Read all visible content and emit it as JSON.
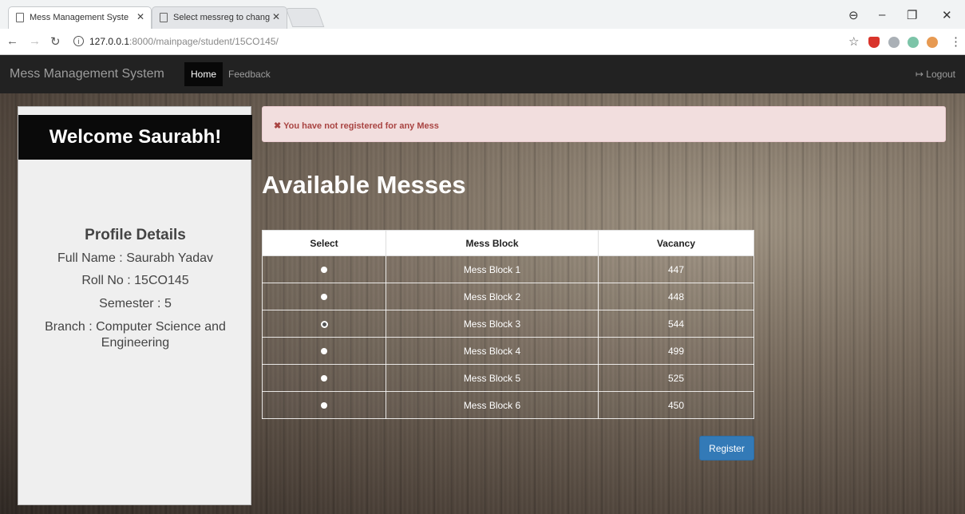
{
  "browser": {
    "tabs": [
      {
        "title": "Mess Management Syste"
      },
      {
        "title": "Select messreg to chang"
      }
    ],
    "url_host": "127.0.0.1",
    "url_rest": ":8000/mainpage/student/15CO145/",
    "info_glyph": "i"
  },
  "navbar": {
    "brand": "Mess Management System",
    "home": "Home",
    "feedback": "Feedback",
    "logout": "Logout",
    "logout_icon": "↦"
  },
  "sidebar": {
    "welcome": "Welcome Saurabh!",
    "profile_title": "Profile Details",
    "full_name": "Full Name : Saurabh Yadav",
    "roll_no": "Roll No : 15CO145",
    "semester": "Semester : 5",
    "branch_line1": "Branch : Computer Science and",
    "branch_line2": "Engineering"
  },
  "alert": {
    "icon": "✖",
    "text": "You have not registered for any Mess"
  },
  "main": {
    "heading": "Available Messes",
    "columns": [
      "Select",
      "Mess Block",
      "Vacancy"
    ],
    "rows": [
      {
        "block": "Mess Block 1",
        "vacancy": "447",
        "selected": false
      },
      {
        "block": "Mess Block 2",
        "vacancy": "448",
        "selected": false
      },
      {
        "block": "Mess Block 3",
        "vacancy": "544",
        "selected": true
      },
      {
        "block": "Mess Block 4",
        "vacancy": "499",
        "selected": false
      },
      {
        "block": "Mess Block 5",
        "vacancy": "525",
        "selected": false
      },
      {
        "block": "Mess Block 6",
        "vacancy": "450",
        "selected": false
      }
    ],
    "register_label": "Register"
  },
  "colors": {
    "navbar_bg": "#222222",
    "alert_bg": "#f2dede",
    "alert_text": "#a94442",
    "button": "#337ab7"
  }
}
